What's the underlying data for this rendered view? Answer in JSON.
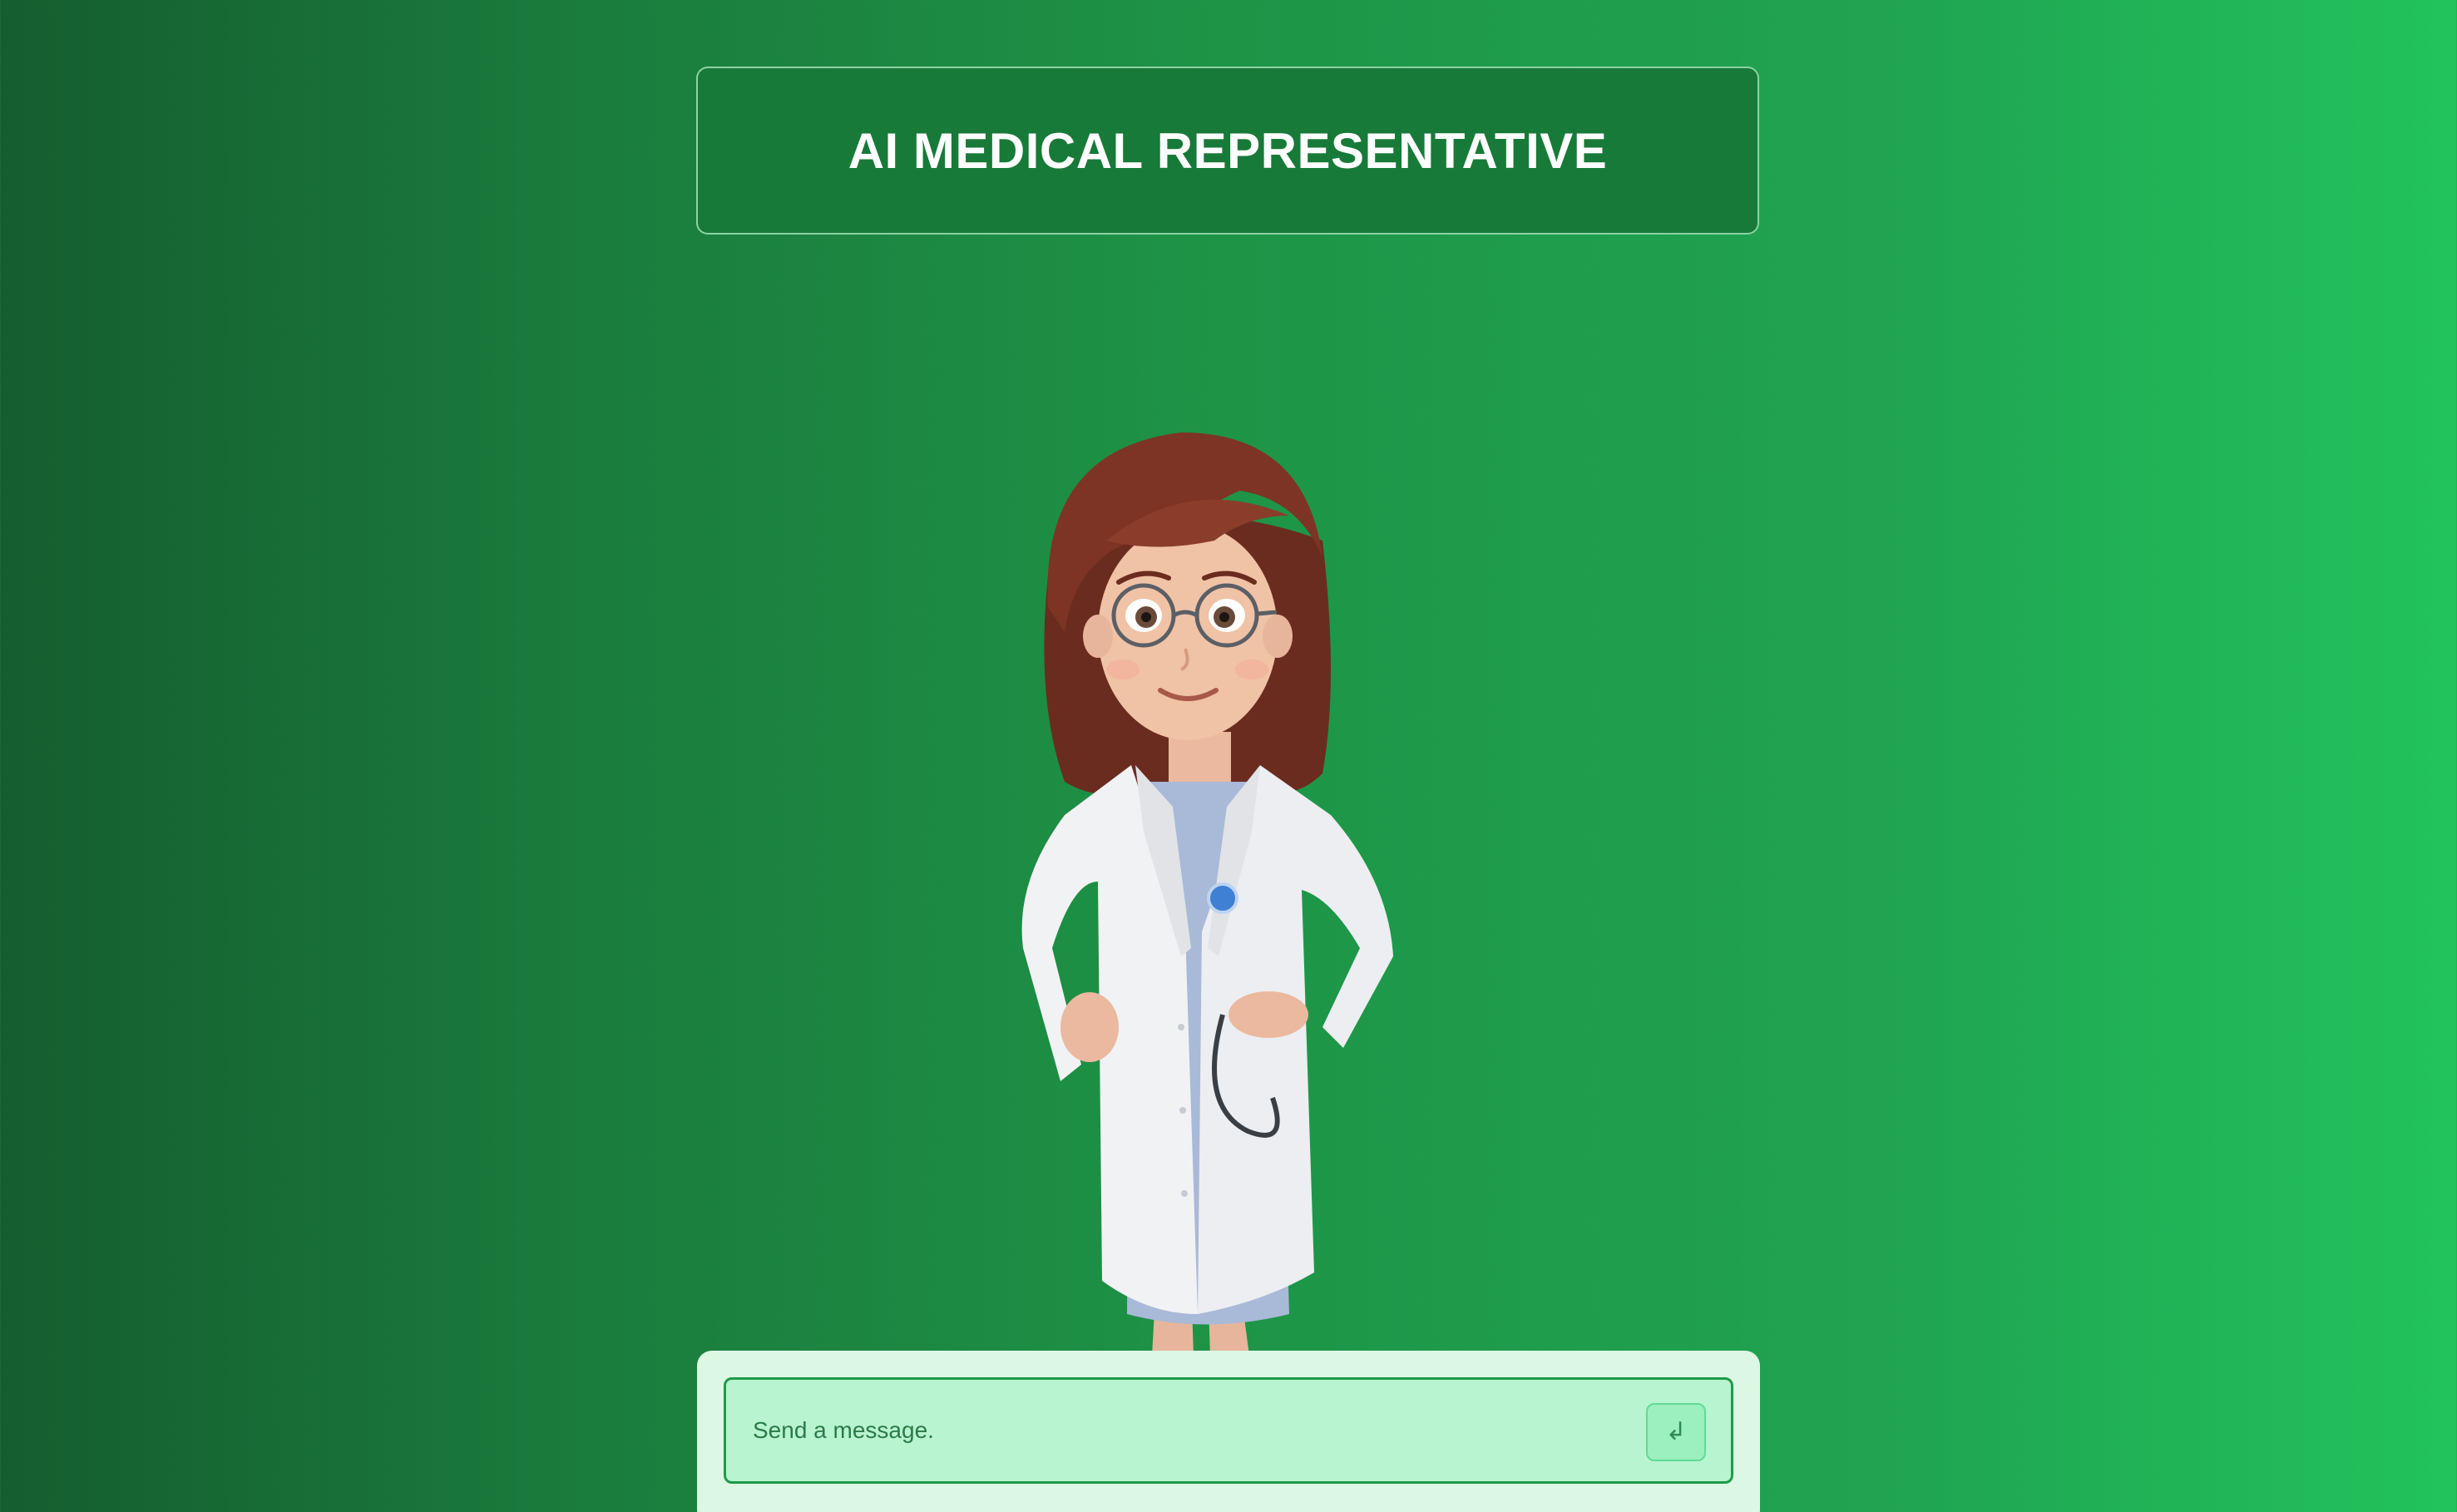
{
  "header": {
    "title": "AI MEDICAL REPRESENTATIVE"
  },
  "avatar": {
    "description_icon": "doctor-avatar"
  },
  "chat": {
    "input_placeholder": "Send a message.",
    "input_value": "",
    "send_icon": "return-arrow-icon",
    "send_glyph": "↲"
  },
  "colors": {
    "background_start": "#155d2f",
    "background_end": "#22c35c",
    "title_box": "#187a38",
    "panel": "#dcf7e4",
    "input_bg": "#b8f4d0",
    "input_border": "#1f9a4a"
  }
}
